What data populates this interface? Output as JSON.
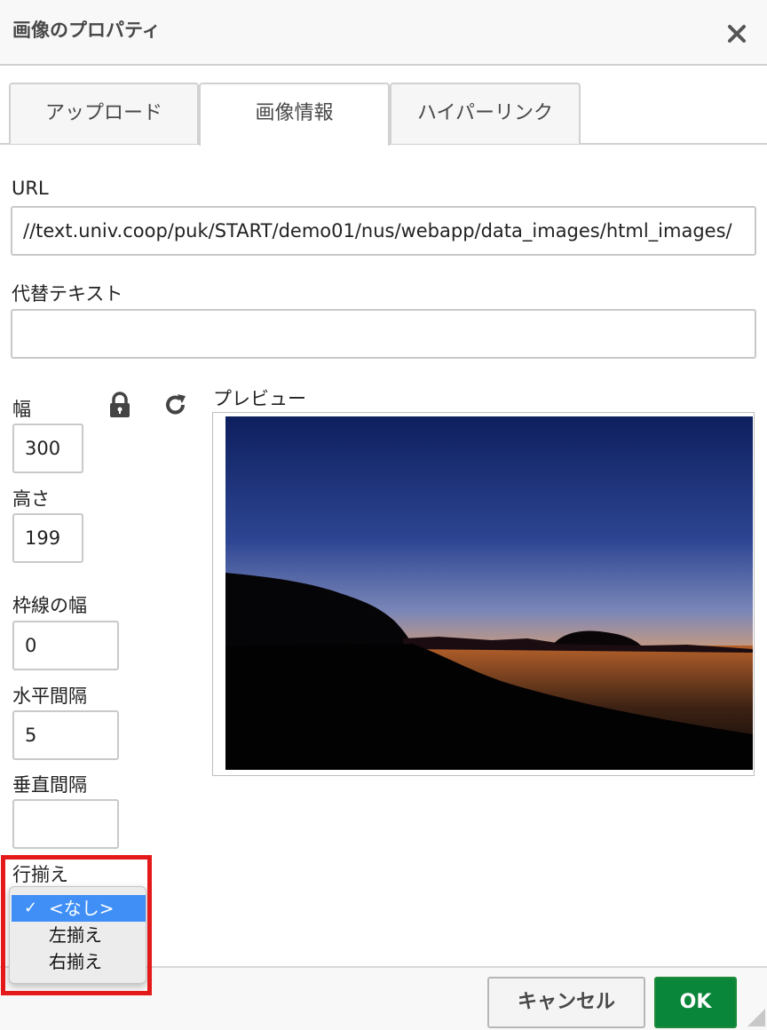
{
  "dialog": {
    "title": "画像のプロパティ",
    "close_icon": "close-icon"
  },
  "tabs": [
    {
      "label": "アップロード",
      "active": false
    },
    {
      "label": "画像情報",
      "active": true
    },
    {
      "label": "ハイパーリンク",
      "active": false
    }
  ],
  "form": {
    "url_label": "URL",
    "url_value": "//text.univ.coop/puk/START/demo01/nus/webapp/data_images/html_images/",
    "alt_label": "代替テキスト",
    "alt_value": "",
    "width_label": "幅",
    "width_value": "300",
    "height_label": "高さ",
    "height_value": "199",
    "lock_icon": "lock-icon",
    "reset_icon": "reset-icon",
    "border_label": "枠線の幅",
    "border_value": "0",
    "hspace_label": "水平間隔",
    "hspace_value": "5",
    "vspace_label": "垂直間隔",
    "vspace_value": "",
    "align_label": "行揃え",
    "align_options": [
      {
        "label": "<なし>",
        "selected": true
      },
      {
        "label": "左揃え",
        "selected": false
      },
      {
        "label": "右揃え",
        "selected": false
      }
    ],
    "preview_label": "プレビュー"
  },
  "footer": {
    "cancel_label": "キャンセル",
    "ok_label": "OK"
  },
  "colors": {
    "ok_button": "#09863a",
    "highlight": "#e41a1a",
    "selected_option": "#3f8ff7"
  }
}
